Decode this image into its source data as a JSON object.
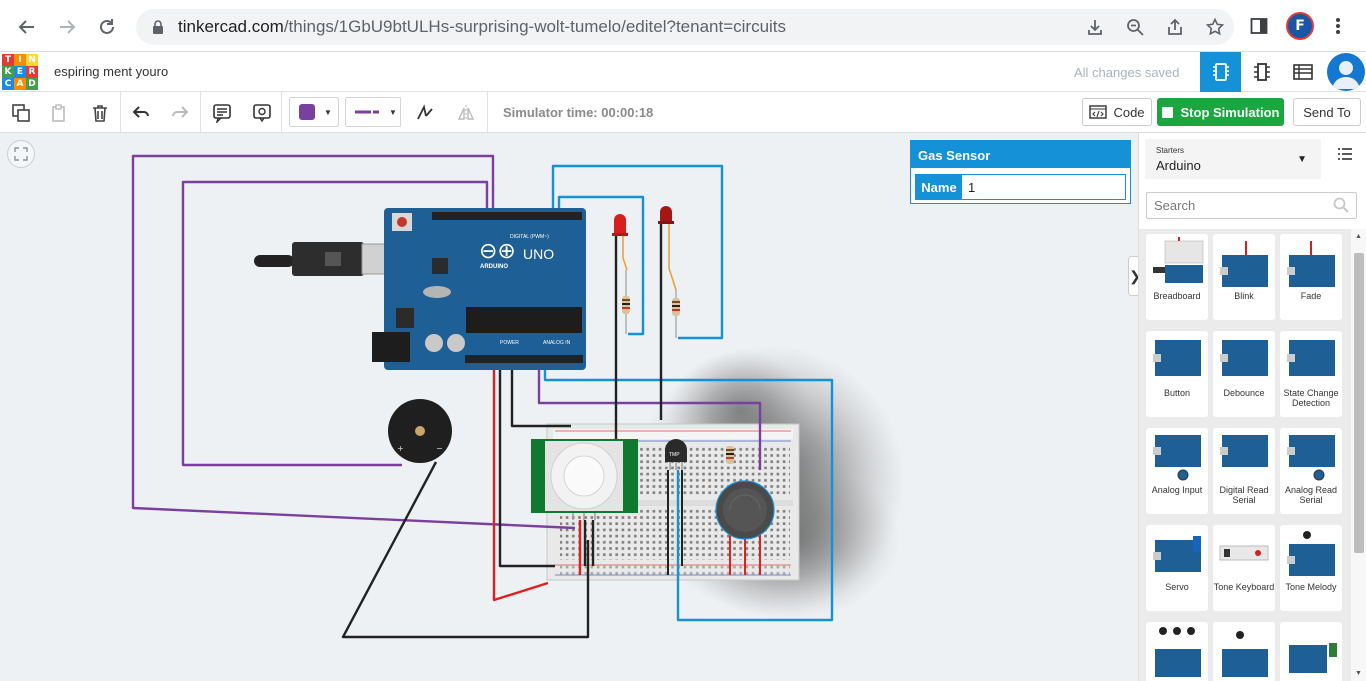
{
  "browser": {
    "url_host": "tinkercad.com",
    "url_path": "/things/1GbU9btULHs-surprising-wolt-tumelo/editel?tenant=circuits",
    "profile_letter": "F"
  },
  "header": {
    "logo_letters": [
      "T",
      "I",
      "N",
      "K",
      "E",
      "R",
      "C",
      "A",
      "D"
    ],
    "project_name": "espiring ment youro",
    "save_status": "All changes saved"
  },
  "toolbar": {
    "simulator_time": "Simulator time: 00:00:18",
    "code_label": "Code",
    "stop_label": "Stop Simulation",
    "send_label": "Send To",
    "fill_color": "#7b3fa0"
  },
  "inspector": {
    "title": "Gas Sensor",
    "name_label": "Name",
    "name_value": "1"
  },
  "board": {
    "uno_label": "UNO",
    "brand_label": "ARDUINO",
    "digital_label": "DIGITAL (PWM~)",
    "power_label": "POWER",
    "analog_label": "ANALOG IN",
    "temp_label": "TMP"
  },
  "panel": {
    "starters_label": "Starters",
    "starters_value": "Arduino",
    "search_placeholder": "Search",
    "items": [
      {
        "label": "Breadboard",
        "thumb": "breadboard"
      },
      {
        "label": "Blink",
        "thumb": "uno"
      },
      {
        "label": "Fade",
        "thumb": "uno"
      },
      {
        "label": "Button",
        "thumb": "uno"
      },
      {
        "label": "Debounce",
        "thumb": "uno"
      },
      {
        "label": "State Change Detection",
        "thumb": "uno"
      },
      {
        "label": "Analog Input",
        "thumb": "uno"
      },
      {
        "label": "Digital Read Serial",
        "thumb": "uno"
      },
      {
        "label": "Analog Read Serial",
        "thumb": "uno"
      },
      {
        "label": "Servo",
        "thumb": "uno"
      },
      {
        "label": "Tone Keyboard",
        "thumb": "keyboard"
      },
      {
        "label": "Tone Melody",
        "thumb": "uno"
      },
      {
        "label": "",
        "thumb": "uno"
      },
      {
        "label": "",
        "thumb": "uno"
      },
      {
        "label": "",
        "thumb": "uno"
      }
    ]
  },
  "colors": {
    "accent": "#1591d7",
    "stop_green": "#1ba740",
    "wire_purple": "#7b3fa0",
    "wire_blue": "#1591d7",
    "wire_red": "#e02020",
    "wire_black": "#222222",
    "board_blue": "#1e5f95"
  }
}
